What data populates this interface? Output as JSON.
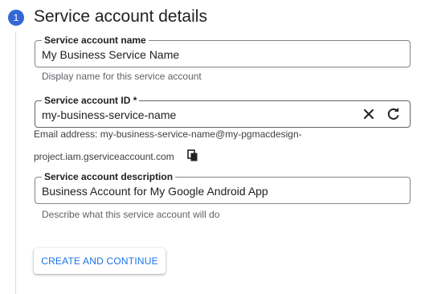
{
  "step": {
    "number": "1",
    "title": "Service account details"
  },
  "fields": {
    "name": {
      "label": "Service account name",
      "value": "My Business Service Name",
      "helper": "Display name for this service account"
    },
    "id": {
      "label": "Service account ID *",
      "value": "my-business-service-name",
      "clear_icon": "close-icon",
      "refresh_icon": "refresh-icon"
    },
    "email": {
      "line1": "Email address: my-business-service-name@my-pgmacdesign-",
      "line2": "project.iam.gserviceaccount.com",
      "copy_icon": "copy-icon"
    },
    "description": {
      "label": "Service account description",
      "value": "Business Account for My Google Android App",
      "helper": "Describe what this service account will do"
    }
  },
  "actions": {
    "create_continue_label": "CREATE AND CONTINUE"
  },
  "colors": {
    "accent": "#1a73e8",
    "step_badge": "#3367d6",
    "border": "#80868b",
    "helper_text": "#5f6368"
  }
}
